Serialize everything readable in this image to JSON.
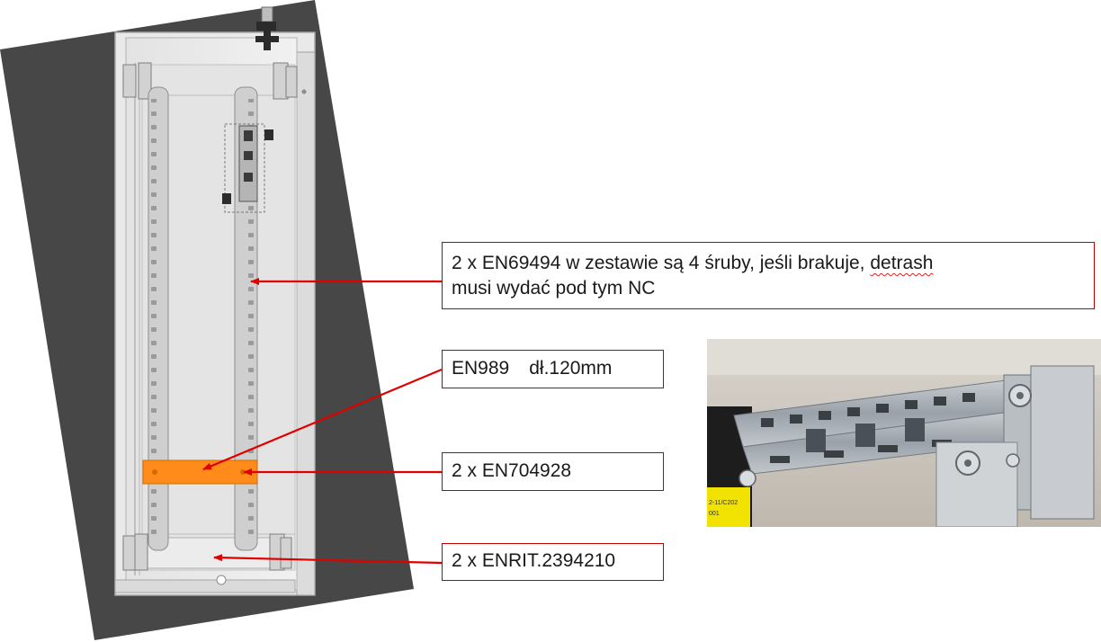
{
  "callouts": {
    "screws": {
      "line1_start": "2 x EN69494 w zestawie są 4 śruby, jeśli brakuje, ",
      "line1_word": "detrash",
      "line2": "musi wydać pod tym NC"
    },
    "bracket": {
      "code": "EN989",
      "length": "dł.120mm"
    },
    "rail": {
      "text": "2 x EN704928"
    },
    "mount": {
      "text": "2 x ENRIT.2394210"
    }
  },
  "photo": {
    "sticker_lines": [
      "2-11/C202",
      "001"
    ]
  },
  "colors": {
    "arrow": "#e00000",
    "box_border": "#c00000",
    "highlight": "#ff8c1a",
    "background_panel": "#474747"
  }
}
